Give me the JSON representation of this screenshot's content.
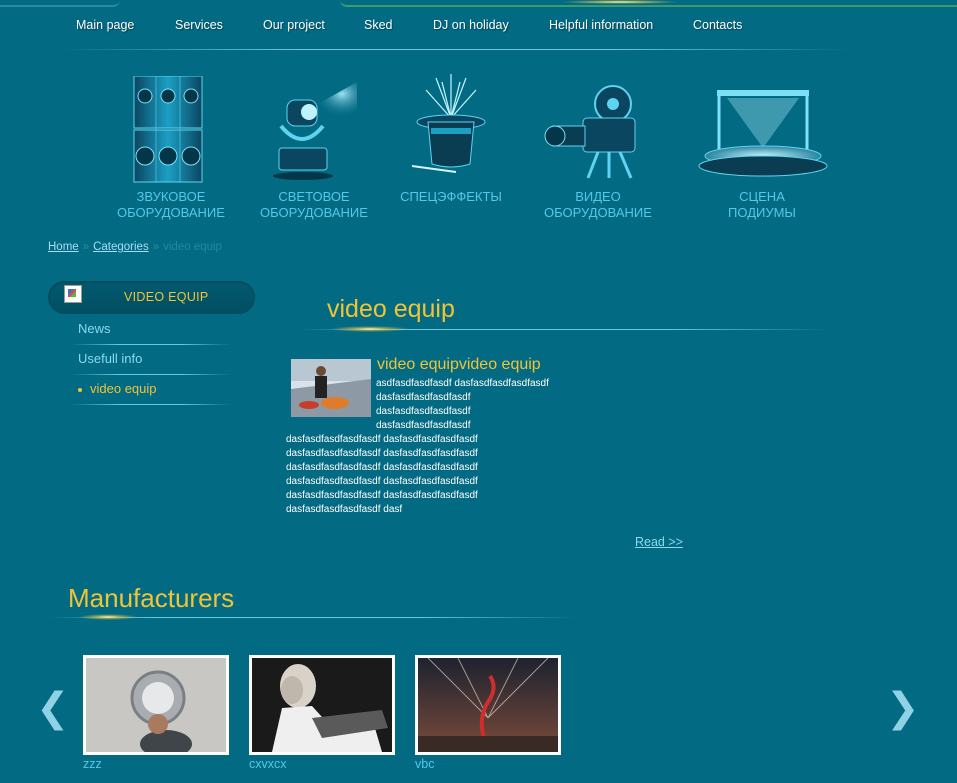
{
  "nav": {
    "items": [
      "Main page",
      "Services",
      "Our project",
      "Sked",
      "DJ on holiday",
      "Helpful information",
      "Contacts"
    ]
  },
  "categories": [
    {
      "line1": "ЗВУКОВОЕ",
      "line2": "ОБОРУДОВАНИЕ",
      "icon": "speaker-stack-icon"
    },
    {
      "line1": "СВЕТОВОЕ",
      "line2": "ОБОРУДОВАНИЕ",
      "icon": "moving-head-light-icon"
    },
    {
      "line1": "СПЕЦЭФФЕКТЫ",
      "line2": "",
      "icon": "magic-hat-fireworks-icon"
    },
    {
      "line1": "ВИДЕО",
      "line2": "ОБОРУДОВАНИЕ",
      "icon": "film-camera-icon"
    },
    {
      "line1": "СЦЕНА",
      "line2": "ПОДИУМЫ",
      "icon": "stage-podium-icon"
    }
  ],
  "breadcrumb": {
    "home": "Home",
    "categories": "Categories",
    "separator": "»",
    "current": "video equip"
  },
  "sidebar": {
    "heading": "VIDEO EQUIP",
    "items": [
      {
        "label": "News"
      },
      {
        "label": "Usefull info"
      },
      {
        "label": "video equip"
      }
    ]
  },
  "page": {
    "title": "video equip"
  },
  "article": {
    "title": "video equipvideo equip",
    "lines_short": [
      "asdfasdfasdfasdf dasfasdfasdfasdfasdf",
      "dasfasdfasdfasdfasdf",
      "dasfasdfasdfasdfasdf",
      "dasfasdfasdfasdfasdf"
    ],
    "lines_long": [
      "dasfasdfasdfasdfasdf dasfasdfasdfasdfasdf",
      "dasfasdfasdfasdfasdf dasfasdfasdfasdfasdf",
      "dasfasdfasdfasdfasdf dasfasdfasdfasdfasdf",
      "dasfasdfasdfasdfasdf dasfasdfasdfasdfasdf",
      "dasfasdfasdfasdfasdf dasfasdfasdfasdfasdf",
      "dasfasdfasdfasdfasdf dasf"
    ],
    "read_more": "Read >>"
  },
  "manufacturers": {
    "title": "Manufacturers",
    "prev": "❮",
    "next": "❯",
    "items": [
      {
        "caption": "zzz"
      },
      {
        "caption": "cxvxcx"
      },
      {
        "caption": "vbc"
      }
    ]
  },
  "colors": {
    "background": "#036a84",
    "accent": "#f0c435",
    "link": "#8ad8ee",
    "category_text": "#53c8e8"
  }
}
